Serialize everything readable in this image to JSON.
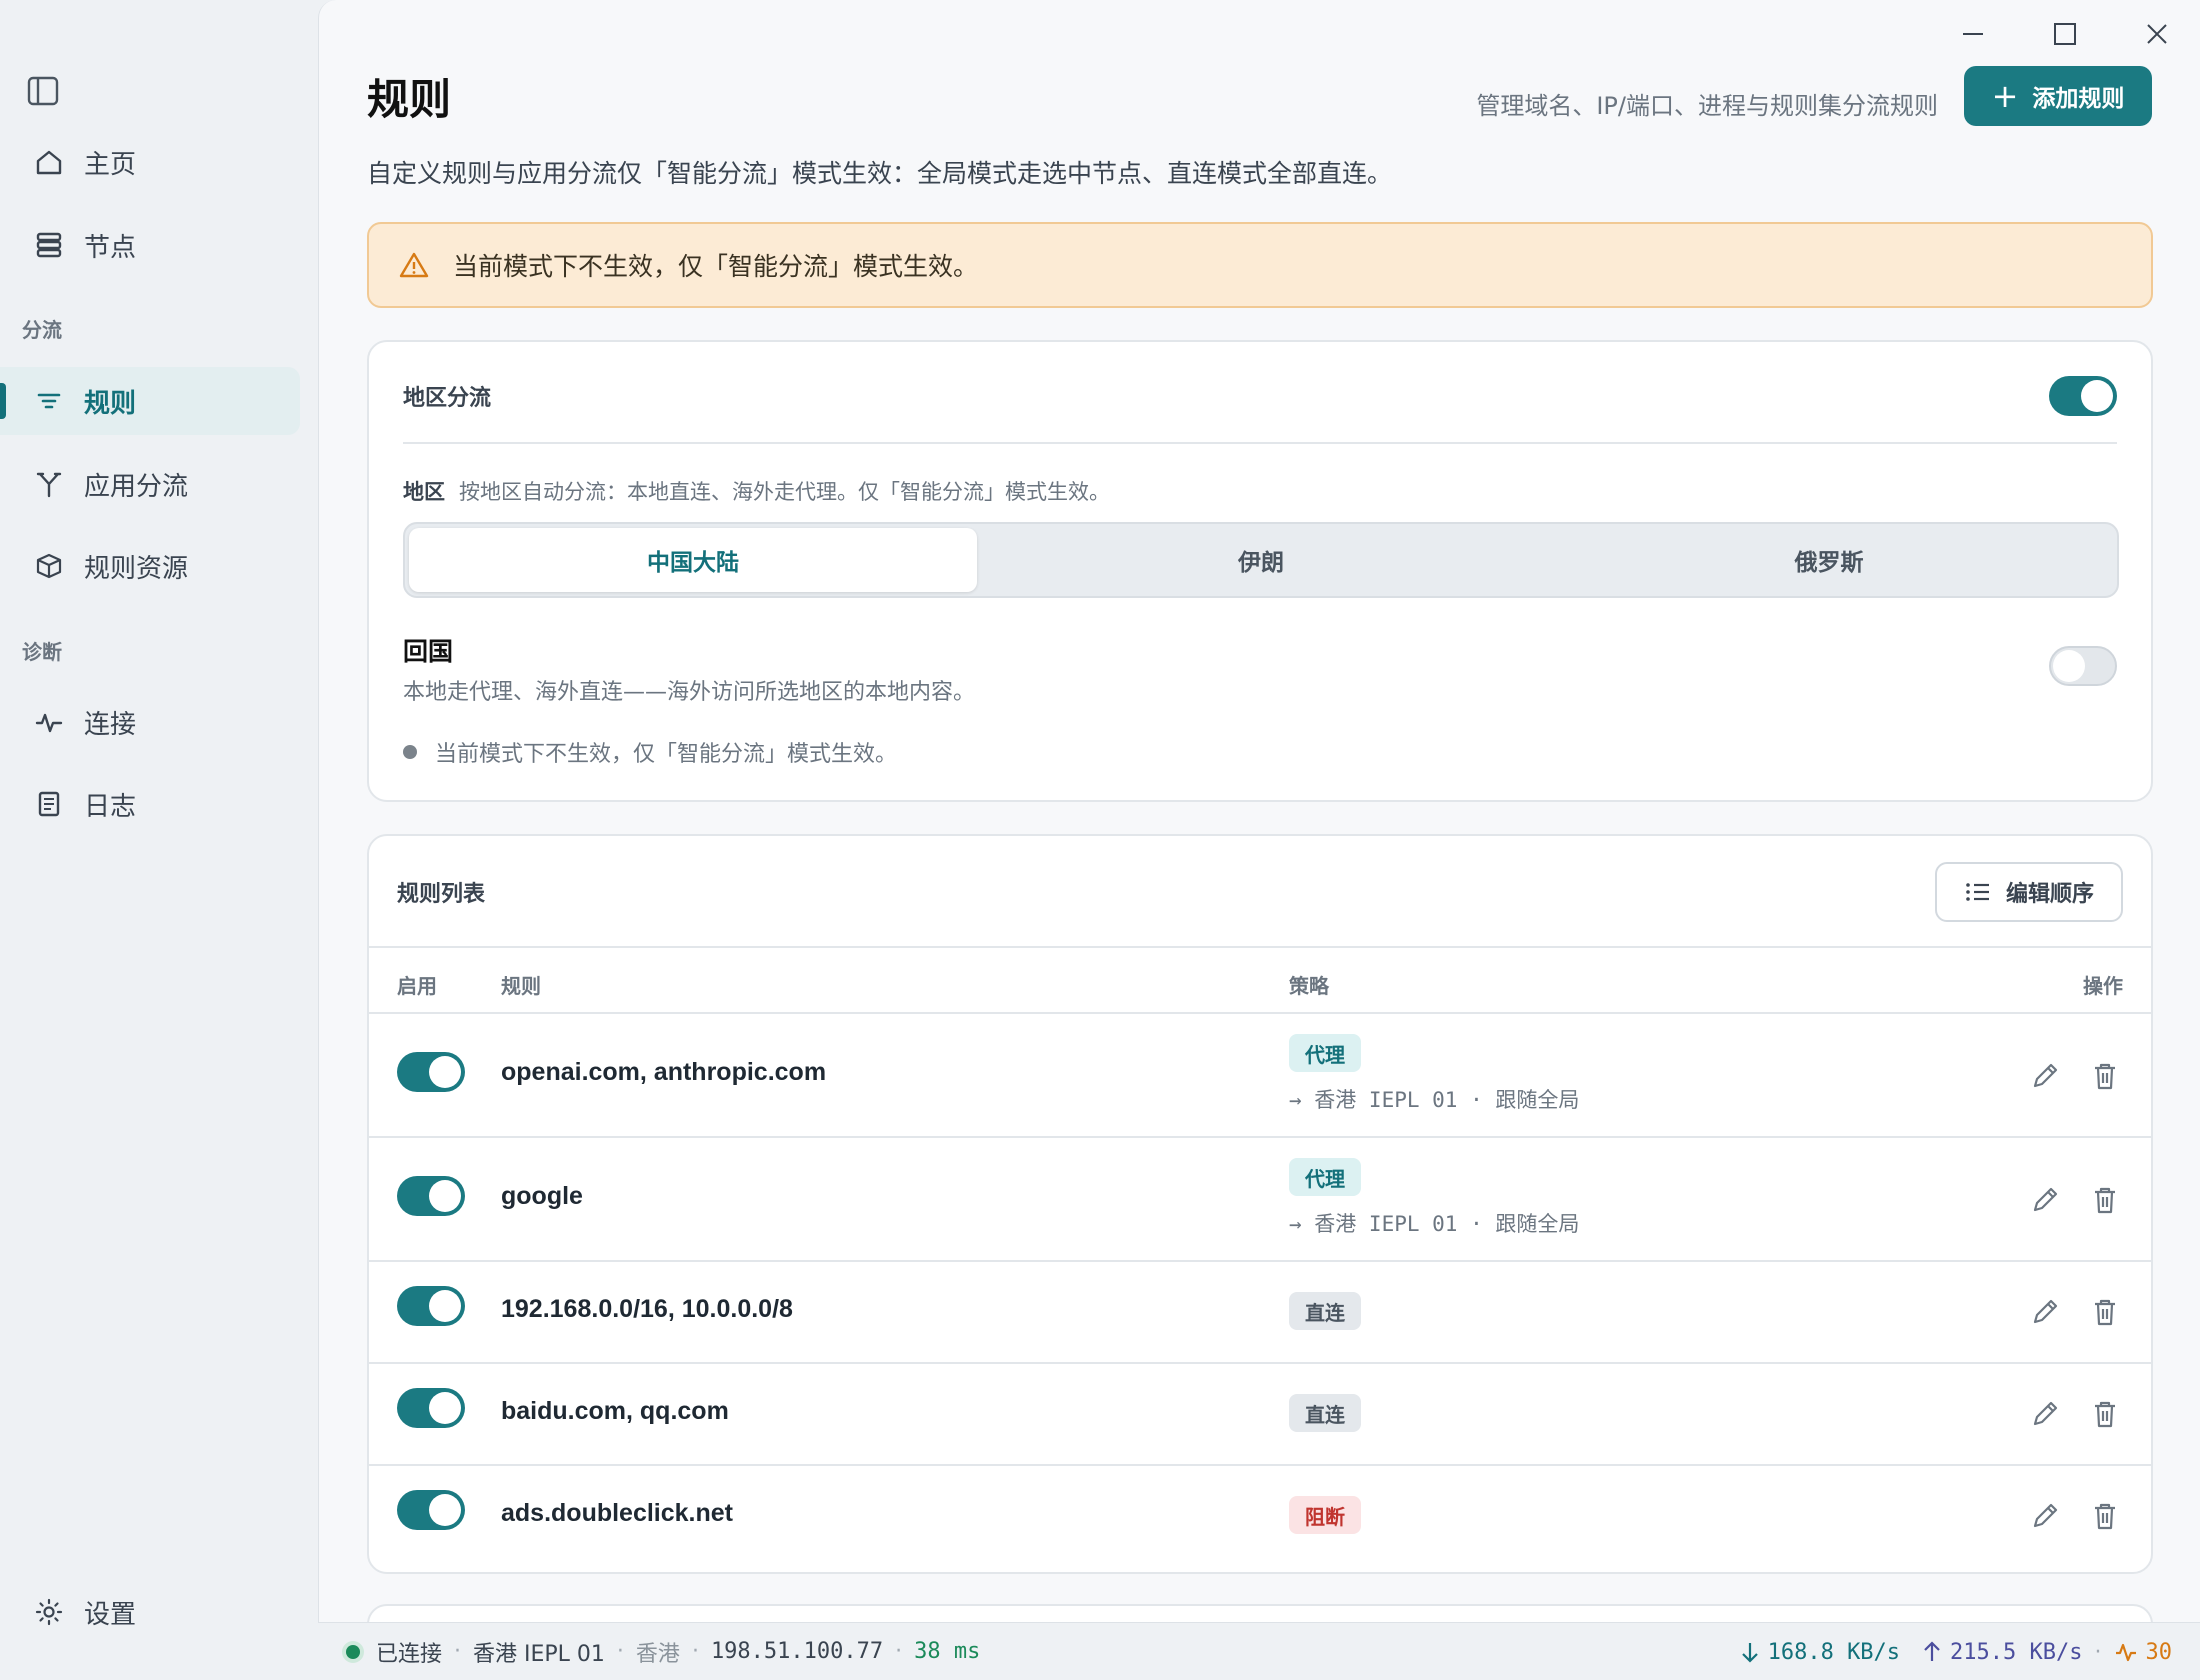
{
  "sidebar": {
    "items": [
      {
        "label": "主页",
        "icon": "home-icon"
      },
      {
        "label": "节点",
        "icon": "server-icon"
      },
      {
        "label": "规则",
        "icon": "filter-icon",
        "active": true
      },
      {
        "label": "应用分流",
        "icon": "split-icon"
      },
      {
        "label": "规则资源",
        "icon": "box-icon"
      },
      {
        "label": "连接",
        "icon": "activity-icon"
      },
      {
        "label": "日志",
        "icon": "log-icon"
      },
      {
        "label": "设置",
        "icon": "gear-icon"
      }
    ],
    "sections": {
      "split": "分流",
      "diagnose": "诊断"
    }
  },
  "header": {
    "title": "规则",
    "subtitle": "管理域名、IP/端口、进程与规则集分流规则",
    "add_label": "添加规则",
    "description": "自定义规则与应用分流仅「智能分流」模式生效：全局模式走选中节点、直连模式全部直连。"
  },
  "warning": {
    "text": "当前模式下不生效，仅「智能分流」模式生效。"
  },
  "geo": {
    "title": "地区分流",
    "enabled": true,
    "region_label": "地区",
    "region_hint": "按地区自动分流：本地直连、海外走代理。仅「智能分流」模式生效。",
    "regions": [
      "中国大陆",
      "伊朗",
      "俄罗斯"
    ],
    "selected_region": "中国大陆",
    "return_title": "回国",
    "return_desc": "本地走代理、海外直连——海外访问所选地区的本地内容。",
    "return_enabled": false,
    "return_note": "当前模式下不生效，仅「智能分流」模式生效。"
  },
  "rules": {
    "title": "规则列表",
    "order_label": "编辑顺序",
    "columns": {
      "enabled": "启用",
      "rule": "规则",
      "policy": "策略",
      "actions": "操作"
    },
    "rows": [
      {
        "rule": "openai.com, anthropic.com",
        "policy": "代理",
        "policy_type": "proxy",
        "target": "→ 香港 IEPL 01 · 跟随全局",
        "enabled": true
      },
      {
        "rule": "google",
        "policy": "代理",
        "policy_type": "proxy",
        "target": "→ 香港 IEPL 01 · 跟随全局",
        "enabled": true
      },
      {
        "rule": "192.168.0.0/16, 10.0.0.0/8",
        "policy": "直连",
        "policy_type": "direct",
        "target": "",
        "enabled": true
      },
      {
        "rule": "baidu.com, qq.com",
        "policy": "直连",
        "policy_type": "direct",
        "target": "",
        "enabled": true
      },
      {
        "rule": "ads.doubleclick.net",
        "policy": "阻断",
        "policy_type": "block",
        "target": "",
        "enabled": true
      }
    ]
  },
  "status": {
    "state": "已连接",
    "node": "香港 IEPL 01",
    "region": "香港",
    "ip": "198.51.100.77",
    "latency": "38 ms",
    "down": "168.8 KB/s",
    "up": "215.5 KB/s",
    "conn": "30"
  },
  "colors": {
    "accent": "#1b7a82",
    "warning_bg": "#fcebd5",
    "connected": "#1b8a5a"
  }
}
